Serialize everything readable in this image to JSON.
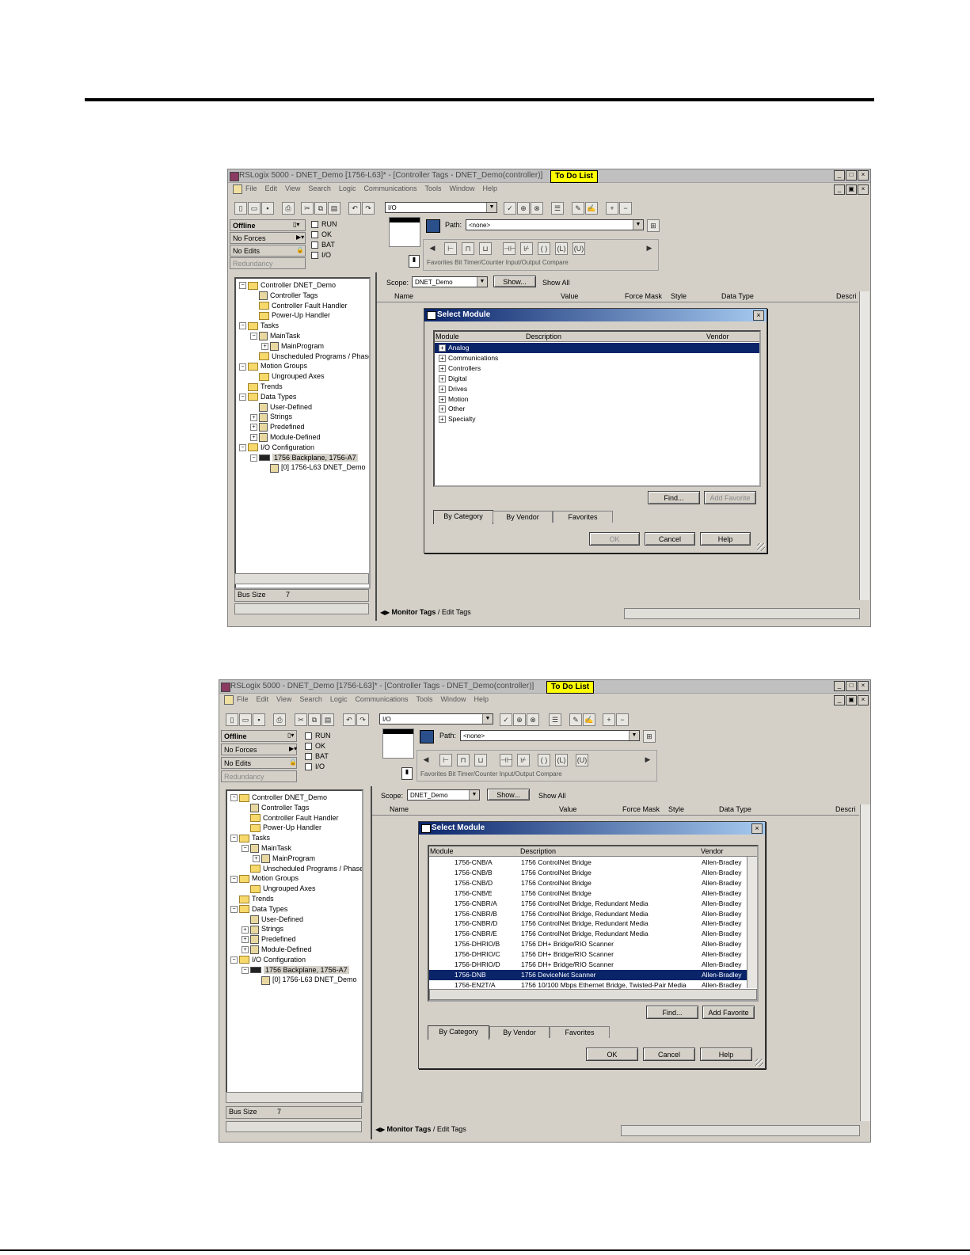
{
  "colors": {
    "chrome": "#d4d0c8",
    "selection": "#0a246a",
    "todo": "#ffff00"
  },
  "screens": [
    {
      "title": "RSLogix 5000 - DNET_Demo [1756-L63]* - [Controller Tags - DNET_Demo(controller)]",
      "todo": "To Do List",
      "menu": [
        "File",
        "Edit",
        "View",
        "Search",
        "Logic",
        "Communications",
        "Tools",
        "Window",
        "Help"
      ],
      "combo_value": "I/O",
      "path_label": "Path:",
      "path_value": "<none>",
      "status": {
        "offline": "Offline",
        "forces": "No Forces",
        "edits": "No Edits",
        "redundancy": "Redundancy"
      },
      "checks": [
        "RUN",
        "OK",
        "BAT",
        "I/O"
      ],
      "instr_tabs": "Favorites  Bit  Timer/Counter  Input/Output  Compare",
      "tree": [
        {
          "label": "Controller DNET_Demo",
          "level": 0,
          "exp": "-",
          "icon": "folder"
        },
        {
          "label": "Controller Tags",
          "level": 1,
          "exp": "",
          "icon": "tags"
        },
        {
          "label": "Controller Fault Handler",
          "level": 1,
          "exp": "",
          "icon": "folder"
        },
        {
          "label": "Power-Up Handler",
          "level": 1,
          "exp": "",
          "icon": "folder"
        },
        {
          "label": "Tasks",
          "level": 0,
          "exp": "-",
          "icon": "folder"
        },
        {
          "label": "MainTask",
          "level": 1,
          "exp": "-",
          "icon": "task"
        },
        {
          "label": "MainProgram",
          "level": 2,
          "exp": "+",
          "icon": "task"
        },
        {
          "label": "Unscheduled Programs / Phases",
          "level": 1,
          "exp": "",
          "icon": "folder"
        },
        {
          "label": "Motion Groups",
          "level": 0,
          "exp": "-",
          "icon": "folder"
        },
        {
          "label": "Ungrouped Axes",
          "level": 1,
          "exp": "",
          "icon": "folder"
        },
        {
          "label": "Trends",
          "level": 0,
          "exp": "",
          "icon": "folder"
        },
        {
          "label": "Data Types",
          "level": 0,
          "exp": "-",
          "icon": "folder"
        },
        {
          "label": "User-Defined",
          "level": 1,
          "exp": "",
          "icon": "tags"
        },
        {
          "label": "Strings",
          "level": 1,
          "exp": "+",
          "icon": "tags"
        },
        {
          "label": "Predefined",
          "level": 1,
          "exp": "+",
          "icon": "tags"
        },
        {
          "label": "Module-Defined",
          "level": 1,
          "exp": "+",
          "icon": "tags"
        },
        {
          "label": "I/O Configuration",
          "level": 0,
          "exp": "-",
          "icon": "folder"
        },
        {
          "label": "1756 Backplane, 1756-A7",
          "level": 1,
          "exp": "-",
          "icon": "rack"
        },
        {
          "label": "[0] 1756-L63 DNET_Demo",
          "level": 2,
          "exp": "",
          "icon": "module"
        }
      ],
      "bus_size_label": "Bus Size",
      "bus_size_value": "7",
      "scope_label": "Scope:",
      "scope_value": "DNET_Demo",
      "show_btn": "Show...",
      "show_value": "Show All",
      "columns": [
        "Name",
        "Value",
        "Force Mask",
        "Style",
        "Data Type",
        "Descri"
      ],
      "bottom_tabs": [
        "Monitor Tags",
        "Edit Tags"
      ],
      "dialog": {
        "title": "Select Module",
        "headers": [
          "Module",
          "Description",
          "Vendor"
        ],
        "rows": [
          {
            "module": "Analog",
            "desc": "",
            "vendor": "",
            "sel": true,
            "exp": "+"
          },
          {
            "module": "Communications",
            "desc": "",
            "vendor": "",
            "sel": false,
            "exp": "+"
          },
          {
            "module": "Controllers",
            "desc": "",
            "vendor": "",
            "sel": false,
            "exp": "+"
          },
          {
            "module": "Digital",
            "desc": "",
            "vendor": "",
            "sel": false,
            "exp": "+"
          },
          {
            "module": "Drives",
            "desc": "",
            "vendor": "",
            "sel": false,
            "exp": "+"
          },
          {
            "module": "Motion",
            "desc": "",
            "vendor": "",
            "sel": false,
            "exp": "+"
          },
          {
            "module": "Other",
            "desc": "",
            "vendor": "",
            "sel": false,
            "exp": "+"
          },
          {
            "module": "Specialty",
            "desc": "",
            "vendor": "",
            "sel": false,
            "exp": "+"
          }
        ],
        "find": "Find...",
        "add_favorite": "Add Favorite",
        "tabs": [
          "By Category",
          "By Vendor",
          "Favorites"
        ],
        "ok": "OK",
        "cancel": "Cancel",
        "help": "Help"
      }
    },
    {
      "title": "RSLogix 5000 - DNET_Demo [1756-L63]* - [Controller Tags - DNET_Demo(controller)]",
      "todo": "To Do List",
      "menu": [
        "File",
        "Edit",
        "View",
        "Search",
        "Logic",
        "Communications",
        "Tools",
        "Window",
        "Help"
      ],
      "combo_value": "I/O",
      "path_label": "Path:",
      "path_value": "<none>",
      "status": {
        "offline": "Offline",
        "forces": "No Forces",
        "edits": "No Edits",
        "redundancy": "Redundancy"
      },
      "checks": [
        "RUN",
        "OK",
        "BAT",
        "I/O"
      ],
      "instr_tabs": "Favorites  Bit  Timer/Counter  Input/Output  Compare",
      "tree": [
        {
          "label": "Controller DNET_Demo",
          "level": 0,
          "exp": "-",
          "icon": "folder"
        },
        {
          "label": "Controller Tags",
          "level": 1,
          "exp": "",
          "icon": "tags"
        },
        {
          "label": "Controller Fault Handler",
          "level": 1,
          "exp": "",
          "icon": "folder"
        },
        {
          "label": "Power-Up Handler",
          "level": 1,
          "exp": "",
          "icon": "folder"
        },
        {
          "label": "Tasks",
          "level": 0,
          "exp": "-",
          "icon": "folder"
        },
        {
          "label": "MainTask",
          "level": 1,
          "exp": "-",
          "icon": "task"
        },
        {
          "label": "MainProgram",
          "level": 2,
          "exp": "+",
          "icon": "task"
        },
        {
          "label": "Unscheduled Programs / Phases",
          "level": 1,
          "exp": "",
          "icon": "folder"
        },
        {
          "label": "Motion Groups",
          "level": 0,
          "exp": "-",
          "icon": "folder"
        },
        {
          "label": "Ungrouped Axes",
          "level": 1,
          "exp": "",
          "icon": "folder"
        },
        {
          "label": "Trends",
          "level": 0,
          "exp": "",
          "icon": "folder"
        },
        {
          "label": "Data Types",
          "level": 0,
          "exp": "-",
          "icon": "folder"
        },
        {
          "label": "User-Defined",
          "level": 1,
          "exp": "",
          "icon": "tags"
        },
        {
          "label": "Strings",
          "level": 1,
          "exp": "+",
          "icon": "tags"
        },
        {
          "label": "Predefined",
          "level": 1,
          "exp": "+",
          "icon": "tags"
        },
        {
          "label": "Module-Defined",
          "level": 1,
          "exp": "+",
          "icon": "tags"
        },
        {
          "label": "I/O Configuration",
          "level": 0,
          "exp": "-",
          "icon": "folder"
        },
        {
          "label": "1756 Backplane, 1756-A7",
          "level": 1,
          "exp": "-",
          "icon": "rack"
        },
        {
          "label": "[0] 1756-L63 DNET_Demo",
          "level": 2,
          "exp": "",
          "icon": "module"
        }
      ],
      "bus_size_label": "Bus Size",
      "bus_size_value": "7",
      "scope_label": "Scope:",
      "scope_value": "DNET_Demo",
      "show_btn": "Show...",
      "show_value": "Show All",
      "columns": [
        "Name",
        "Value",
        "Force Mask",
        "Style",
        "Data Type",
        "Descri"
      ],
      "bottom_tabs": [
        "Monitor Tags",
        "Edit Tags"
      ],
      "dialog": {
        "title": "Select Module",
        "headers": [
          "Module",
          "Description",
          "Vendor"
        ],
        "rows": [
          {
            "module": "1756-CNB/A",
            "desc": "1756 ControlNet Bridge",
            "vendor": "Allen-Bradley",
            "sel": false,
            "exp": ""
          },
          {
            "module": "1756-CNB/B",
            "desc": "1756 ControlNet Bridge",
            "vendor": "Allen-Bradley",
            "sel": false,
            "exp": ""
          },
          {
            "module": "1756-CNB/D",
            "desc": "1756 ControlNet Bridge",
            "vendor": "Allen-Bradley",
            "sel": false,
            "exp": ""
          },
          {
            "module": "1756-CNB/E",
            "desc": "1756 ControlNet Bridge",
            "vendor": "Allen-Bradley",
            "sel": false,
            "exp": ""
          },
          {
            "module": "1756-CNBR/A",
            "desc": "1756 ControlNet Bridge, Redundant Media",
            "vendor": "Allen-Bradley",
            "sel": false,
            "exp": ""
          },
          {
            "module": "1756-CNBR/B",
            "desc": "1756 ControlNet Bridge, Redundant Media",
            "vendor": "Allen-Bradley",
            "sel": false,
            "exp": ""
          },
          {
            "module": "1756-CNBR/D",
            "desc": "1756 ControlNet Bridge, Redundant Media",
            "vendor": "Allen-Bradley",
            "sel": false,
            "exp": ""
          },
          {
            "module": "1756-CNBR/E",
            "desc": "1756 ControlNet Bridge, Redundant Media",
            "vendor": "Allen-Bradley",
            "sel": false,
            "exp": ""
          },
          {
            "module": "1756-DHRIO/B",
            "desc": "1756 DH+ Bridge/RIO Scanner",
            "vendor": "Allen-Bradley",
            "sel": false,
            "exp": ""
          },
          {
            "module": "1756-DHRIO/C",
            "desc": "1756 DH+ Bridge/RIO Scanner",
            "vendor": "Allen-Bradley",
            "sel": false,
            "exp": ""
          },
          {
            "module": "1756-DHRIO/D",
            "desc": "1756 DH+ Bridge/RIO Scanner",
            "vendor": "Allen-Bradley",
            "sel": false,
            "exp": ""
          },
          {
            "module": "1756-DNB",
            "desc": "1756 DeviceNet Scanner",
            "vendor": "Allen-Bradley",
            "sel": true,
            "exp": ""
          },
          {
            "module": "1756-EN2T/A",
            "desc": "1756 10/100 Mbps Ethernet Bridge, Twisted-Pair Media",
            "vendor": "Allen-Bradley",
            "sel": false,
            "exp": ""
          }
        ],
        "find": "Find...",
        "add_favorite": "Add Favorite",
        "tabs": [
          "By Category",
          "By Vendor",
          "Favorites"
        ],
        "ok": "OK",
        "cancel": "Cancel",
        "help": "Help"
      }
    }
  ]
}
